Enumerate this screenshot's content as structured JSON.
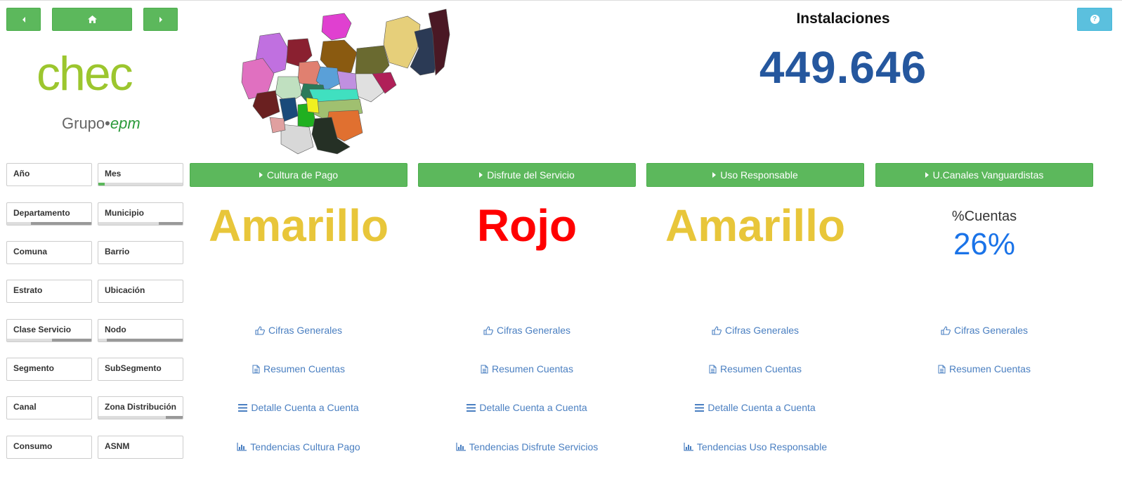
{
  "kpi": {
    "title": "Instalaciones",
    "value": "449.646"
  },
  "logo": {
    "wordmark": "chec",
    "group": "Grupo",
    "group_brand": "epm"
  },
  "filters": [
    {
      "label": "Año"
    },
    {
      "label": "Mes"
    },
    {
      "label": "Departamento"
    },
    {
      "label": "Municipio"
    },
    {
      "label": "Comuna"
    },
    {
      "label": "Barrio"
    },
    {
      "label": "Estrato"
    },
    {
      "label": "Ubicación"
    },
    {
      "label": "Clase Servicio"
    },
    {
      "label": "Nodo"
    },
    {
      "label": "Segmento"
    },
    {
      "label": "SubSegmento"
    },
    {
      "label": "Canal"
    },
    {
      "label": "Zona Distribución"
    },
    {
      "label": "Consumo"
    },
    {
      "label": "ASNM"
    }
  ],
  "sections": [
    {
      "label": "Cultura de Pago",
      "status": "Amarillo",
      "status_color": "#e8c63a"
    },
    {
      "label": "Disfrute del Servicio",
      "status": "Rojo",
      "status_color": "#ff0000"
    },
    {
      "label": "Uso Responsable",
      "status": "Amarillo",
      "status_color": "#e8c63a"
    },
    {
      "label": "U.Canales Vanguardistas",
      "metric_label": "%Cuentas",
      "metric_value": "26%"
    }
  ],
  "links": {
    "cifras": "Cifras Generales",
    "resumen": "Resumen Cuentas",
    "detalle": "Detalle Cuenta a Cuenta",
    "tendencias": [
      "Tendencias Cultura Pago",
      "Tendencias Disfrute Servicios",
      "Tendencias Uso Responsable"
    ]
  },
  "icons": {
    "prev": "caret-left-icon",
    "home": "home-icon",
    "next": "caret-right-icon",
    "help": "question-circle-icon",
    "cifras": "thumbs-up-icon",
    "resumen": "document-icon",
    "detalle": "list-icon",
    "tendencias": "bar-chart-icon"
  },
  "colors": {
    "button_green": "#5cb85c",
    "help_blue": "#5bc0de",
    "kpi_blue": "#25579e",
    "link_blue": "#4a7fc1",
    "pct_blue": "#1a73e8"
  }
}
